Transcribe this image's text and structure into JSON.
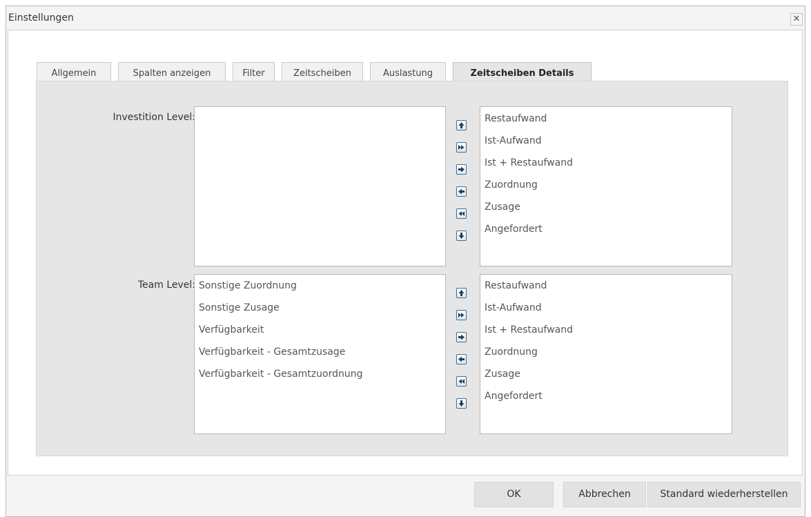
{
  "dialog": {
    "title": "Einstellungen",
    "close_icon": "close-x-icon"
  },
  "tabs": [
    {
      "label": "Allgemein"
    },
    {
      "label": "Spalten anzeigen"
    },
    {
      "label": "Filter"
    },
    {
      "label": "Zeitscheiben"
    },
    {
      "label": "Auslastung"
    },
    {
      "label": "Zeitscheiben Details",
      "active": true
    }
  ],
  "investition": {
    "label": "Investition Level:",
    "available": [],
    "selected": [
      "Restaufwand",
      "Ist-Aufwand",
      "Ist + Restaufwand",
      "Zuordnung",
      "Zusage",
      "Angefordert"
    ]
  },
  "team": {
    "label": "Team Level:",
    "available": [
      "Sonstige Zuordnung",
      "Sonstige Zusage",
      "Verfügbarkeit",
      "Verfügbarkeit - Gesamtzusage",
      "Verfügbarkeit - Gesamtzuordnung"
    ],
    "selected": [
      "Restaufwand",
      "Ist-Aufwand",
      "Ist + Restaufwand",
      "Zuordnung",
      "Zusage",
      "Angefordert"
    ]
  },
  "transfer_buttons": [
    "move-up-icon",
    "move-all-right-icon",
    "move-right-icon",
    "move-left-icon",
    "move-all-left-icon",
    "move-down-icon"
  ],
  "footer": {
    "ok_label": "OK",
    "cancel_label": "Abbrechen",
    "reset_label": "Standard wiederherstellen"
  },
  "colors": {
    "panel_bg": "#e6e6e6",
    "arrow_button_border": "#3b6e96"
  }
}
